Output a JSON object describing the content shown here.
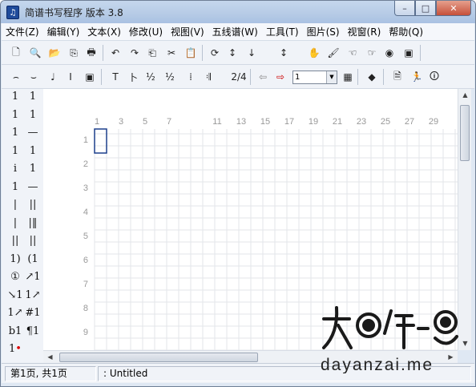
{
  "window": {
    "title": "简谱书写程序  版本 3.8",
    "icon_name": "app-logo-icon"
  },
  "controls": {
    "minimize": "–",
    "maximize": "□",
    "close": "✕"
  },
  "menu": [
    "文件(Z)",
    "编辑(Y)",
    "文本(X)",
    "修改(U)",
    "视图(V)",
    "五线谱(W)",
    "工具(T)",
    "图片(S)",
    "视窗(R)",
    "帮助(Q)"
  ],
  "toolbar1": {
    "icons": [
      "new-doc-icon",
      "open-icon",
      "folder-icon",
      "copy-icon",
      "print-icon",
      "undo-icon",
      "redo-icon",
      "insert-icon",
      "cut-icon",
      "paste-icon",
      "refresh-icon",
      "sort-up-icon",
      "sort-down-icon",
      "sort-az-icon",
      "hand-icon",
      "brush-icon",
      "point-left-icon",
      "point-right-icon",
      "target-icon",
      "snapshot-icon"
    ],
    "glyphs": [
      "🗋",
      "🔍",
      "📂",
      "⎘",
      "🖶",
      "↶",
      "↷",
      "⎗",
      "✂",
      "📋",
      "⟳",
      "↕",
      "↓",
      "↕",
      "✋",
      "🖌",
      "☜",
      "☞",
      "◉",
      "▣"
    ]
  },
  "toolbar2": {
    "icons": [
      "tie-icon",
      "slur-icon",
      "note-icon",
      "text-cursor-icon",
      "frame-icon",
      "text-t-icon",
      "bar-number-icon",
      "chord-icon",
      "chord2-icon",
      "barline-icon",
      "repeat-icon",
      "time-signature-icon",
      "back-arrow-icon",
      "forward-arrow-icon",
      "color-icon",
      "eraser-icon",
      "page-icon",
      "run-icon",
      "info-icon"
    ],
    "glyphs": [
      "⌢",
      "⌣",
      "♩",
      "I",
      "▣",
      "T",
      "卜",
      "½",
      "½",
      "⁞",
      "𝄇",
      "⅔",
      "⇦",
      "⇨",
      "▦",
      "◆",
      "🗎",
      "🏃",
      "🛈"
    ],
    "combo_value": "1",
    "time_sig": "2/4"
  },
  "palette": [
    [
      "1",
      "1"
    ],
    [
      "1",
      "1"
    ],
    [
      "1",
      "—"
    ],
    [
      "1",
      "1"
    ],
    [
      "i",
      "1"
    ],
    [
      "1",
      "—"
    ],
    [
      "|",
      "||"
    ],
    [
      "|",
      "|‖"
    ],
    [
      "||",
      "||"
    ],
    [
      "1)",
      "(1"
    ],
    [
      "①",
      "↗1"
    ],
    [
      "↘1",
      "1↗"
    ],
    [
      "1↗",
      "#1"
    ],
    [
      "b1",
      "¶1"
    ],
    [
      "1•",
      ""
    ]
  ],
  "ruler": {
    "columns": [
      "1",
      "3",
      "5",
      "7",
      "11",
      "13",
      "15",
      "17",
      "19",
      "21",
      "23",
      "25",
      "27",
      "29"
    ],
    "rows": [
      "1",
      "2",
      "3",
      "4",
      "5",
      "6",
      "7",
      "8",
      "9"
    ]
  },
  "status": {
    "page_info": "第1页, 共1页",
    "doc_name": ": Untitled"
  },
  "watermark": {
    "text": "dayanzai.me",
    "mark": "大眼仔-旭"
  }
}
